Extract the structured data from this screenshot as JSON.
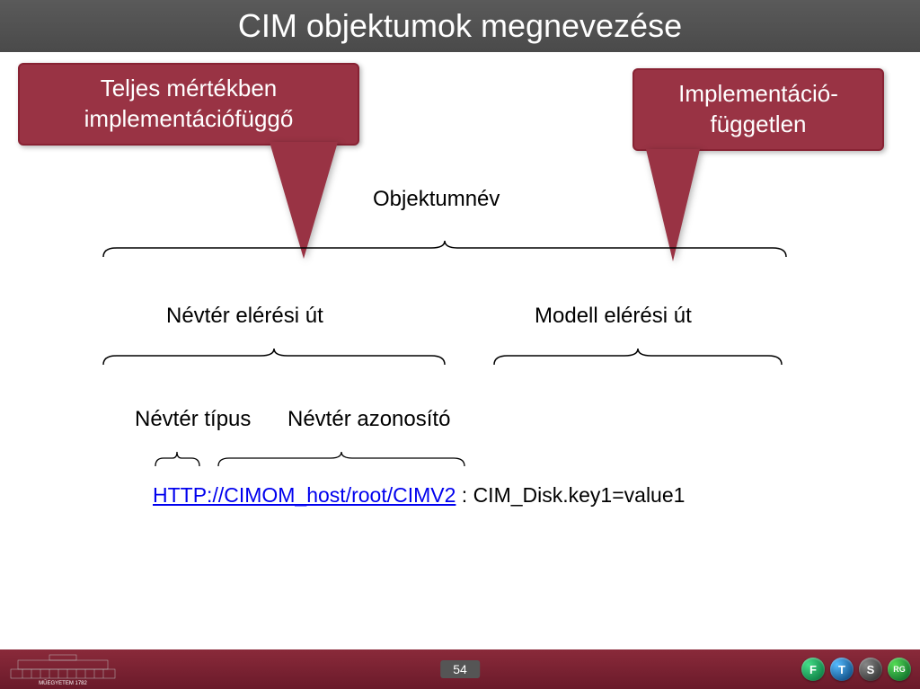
{
  "header": {
    "title": "CIM objektumok megnevezése"
  },
  "callouts": {
    "left": "Teljes mértékben\nimplementációfüggő",
    "right": "Implementáció-\nfüggetlen"
  },
  "labels": {
    "objektumnev": "Objektumnév",
    "nevter_eleresi": "Névtér elérési út",
    "modell": "Modell elérési út",
    "nevter_tipus": "Névtér típus",
    "nevter_azonosito": "Névtér azonosító"
  },
  "url": {
    "link": "HTTP://CIMOM_host/root/CIMV2",
    "rest": " : CIM_Disk.key1=value1"
  },
  "footer": {
    "org": "MŰEGYETEM 1782",
    "page": "54",
    "badges": [
      "F",
      "T",
      "S",
      "RG"
    ]
  }
}
